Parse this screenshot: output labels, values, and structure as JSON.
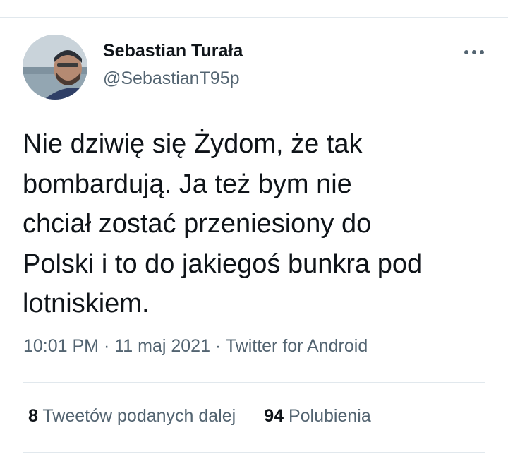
{
  "tweet": {
    "author": {
      "display_name": "Sebastian Turała",
      "handle": "@SebastianT95p",
      "avatar": "profile-photo"
    },
    "text_lines": [
      "Nie dziwię się Żydom, że tak",
      "bombardują. Ja też bym nie",
      "chciał zostać przeniesiony do",
      "Polski i to do jakiegoś bunkra pod",
      "lotniskiem."
    ],
    "time": "10:01 PM",
    "date": "11 maj 2021",
    "separator": " · ",
    "source": "Twitter for Android",
    "stats": {
      "retweets_count": "8",
      "retweets_label": "Tweetów podanych dalej",
      "likes_count": "94",
      "likes_label": "Polubienia"
    },
    "more_icon": "more-horizontal-icon"
  },
  "colors": {
    "text_primary": "#0f1419",
    "text_secondary": "#536471",
    "divider": "#e1e8ed"
  }
}
